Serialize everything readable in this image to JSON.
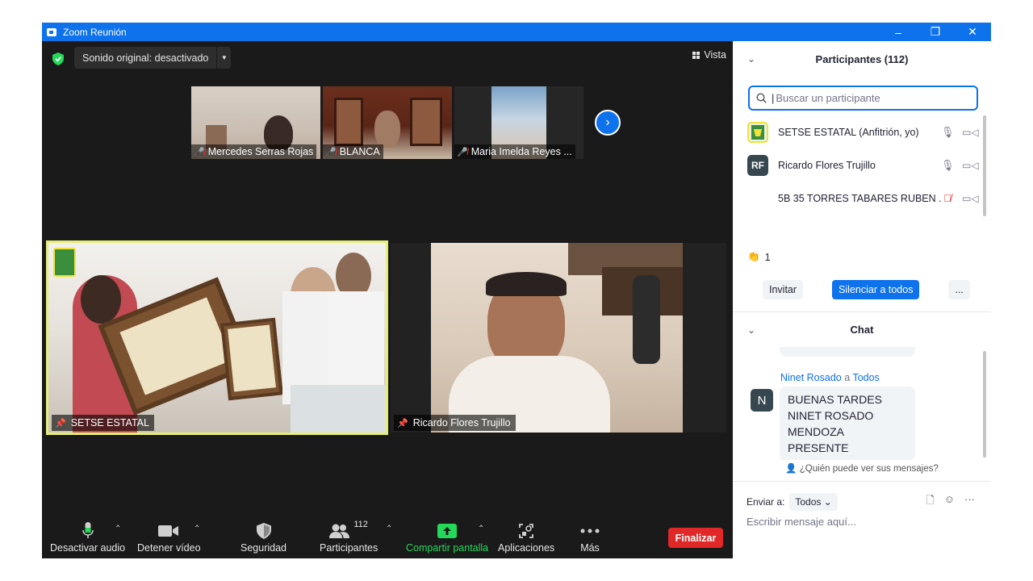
{
  "window": {
    "title": "Zoom Reunión",
    "minimize": "–",
    "restore": "❐",
    "close": "✕"
  },
  "stage": {
    "sound_label": "Sonido original: desactivado",
    "view_label": "Vista",
    "thumbnails": [
      {
        "name": "Mercedes Serras Rojas",
        "muted": true
      },
      {
        "name": "BLANCA",
        "muted": true
      },
      {
        "name": "Maria Imelda Reyes ...",
        "muted": true
      }
    ],
    "main_tiles": [
      {
        "name": "SETSE ESTATAL",
        "pinned": true,
        "active_speaker": true
      },
      {
        "name": "Ricardo Flores Trujillo",
        "pinned": true
      }
    ]
  },
  "toolbar": {
    "audio": "Desactivar audio",
    "video": "Detener vídeo",
    "security": "Seguridad",
    "participants": "Participantes",
    "participants_count": "112",
    "share": "Compartir pantalla",
    "apps": "Aplicaciones",
    "more": "Más",
    "end": "Finalizar"
  },
  "participants_panel": {
    "title": "Participantes (112)",
    "search_placeholder": "Buscar un participante",
    "participants": [
      {
        "name": "SETSE ESTATAL (Anfitrión, yo)",
        "initials": "",
        "muted": false
      },
      {
        "name": "Ricardo Flores Trujillo",
        "initials": "RF",
        "muted": false
      },
      {
        "name": "5B 35 TORRES TABARES RUBEN ...",
        "initials": "",
        "muted": true
      }
    ],
    "reaction_count": "1",
    "invite": "Invitar",
    "mute_all": "Silenciar a todos",
    "more": "..."
  },
  "chat": {
    "title": "Chat",
    "sender": "Ninet Rosado",
    "sender_connector": "a",
    "recipient": "Todos",
    "avatar_initial": "N",
    "message": "BUENAS TARDES NINET ROSADO MENDOZA PRESENTE",
    "who_can_see": "¿Quién puede ver sus mensajes?",
    "send_to_label": "Enviar a:",
    "send_to_value": "Todos",
    "input_placeholder": "Escribir mensaje aquí..."
  },
  "colors": {
    "accent": "#0e72ed",
    "end": "#e02828",
    "share": "#23d959",
    "dark_bg": "#1a1a1a"
  }
}
